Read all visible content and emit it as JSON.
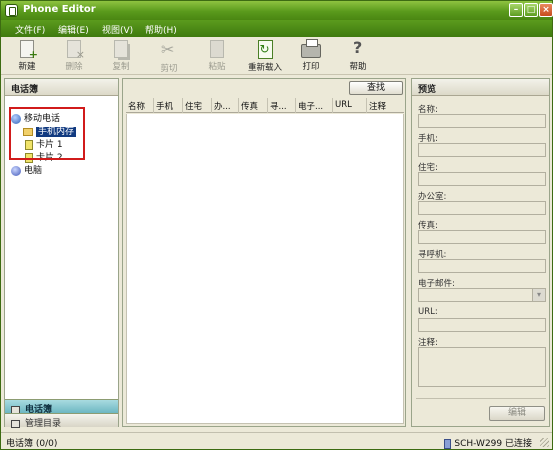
{
  "window": {
    "title": "Phone Editor"
  },
  "menu": [
    {
      "label": "文件(F)"
    },
    {
      "label": "编辑(E)"
    },
    {
      "label": "视图(V)"
    },
    {
      "label": "帮助(H)"
    }
  ],
  "toolbar": [
    {
      "label": "新建",
      "icon": "new-contact-icon",
      "enabled": true
    },
    {
      "label": "删除",
      "icon": "delete-icon",
      "enabled": false
    },
    {
      "label": "复制",
      "icon": "copy-icon",
      "enabled": false
    },
    {
      "label": "剪切",
      "icon": "cut-icon",
      "enabled": false
    },
    {
      "label": "粘贴",
      "icon": "paste-icon",
      "enabled": false
    },
    {
      "label": "重新载入",
      "icon": "reload-icon",
      "enabled": true
    },
    {
      "label": "打印",
      "icon": "printer-icon",
      "enabled": true
    },
    {
      "label": "帮助",
      "icon": "help-icon",
      "enabled": true
    }
  ],
  "left_panel": {
    "title": "电话簿",
    "tree": [
      {
        "label": "移动电话",
        "icon": "phone-icon"
      },
      {
        "label": "手机内存",
        "icon": "folder-icon",
        "selected": true
      },
      {
        "label": "卡片 1",
        "icon": "sim-card-icon"
      },
      {
        "label": "卡片 2",
        "icon": "sim-card-icon"
      },
      {
        "label": "电脑",
        "icon": "computer-icon"
      }
    ],
    "nav": [
      {
        "label": "电话簿",
        "active": true
      },
      {
        "label": "管理目录",
        "active": false
      }
    ]
  },
  "center_panel": {
    "search_label": "查找",
    "columns": [
      "名称",
      "手机",
      "住宅",
      "办...",
      "传真",
      "寻...",
      "电子...",
      "URL",
      "注释"
    ]
  },
  "preview_panel": {
    "title": "预览",
    "fields": [
      {
        "label": "名称:",
        "value": ""
      },
      {
        "label": "手机:",
        "value": ""
      },
      {
        "label": "住宅:",
        "value": ""
      },
      {
        "label": "办公室:",
        "value": ""
      },
      {
        "label": "传真:",
        "value": ""
      },
      {
        "label": "寻呼机:",
        "value": ""
      },
      {
        "label": "电子邮件:",
        "value": ""
      },
      {
        "label": "URL:",
        "value": ""
      },
      {
        "label": "注释:",
        "value": ""
      }
    ],
    "edit_label": "编辑"
  },
  "status": {
    "left": "电话簿 (0/0)",
    "right": "SCH-W299 已连接"
  },
  "colors": {
    "title_bar": "#5a9a1c",
    "menu_bar": "#4a8612",
    "selection": "#113a80",
    "annotation_box": "#d11b1b"
  }
}
